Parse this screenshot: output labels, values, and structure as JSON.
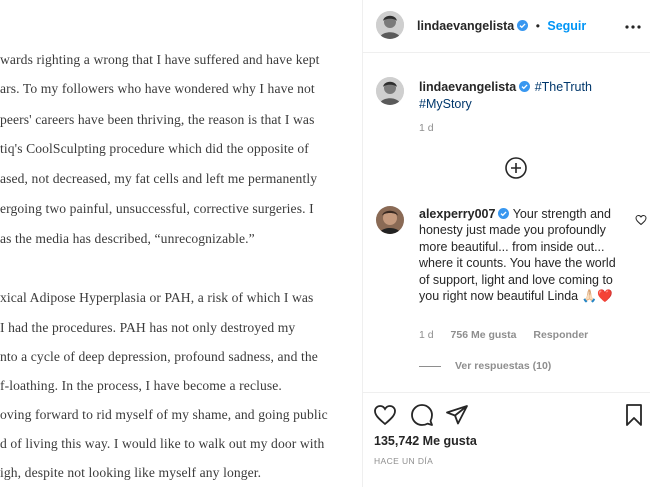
{
  "post_image": {
    "letter_lines": [
      "wards righting a wrong that I have suffered and have kept",
      "ars. To my followers who have wondered why I have not",
      "peers' careers have been thriving, the reason is that I was",
      "tiq's CoolSculpting procedure which did the opposite of",
      "ased, not decreased, my fat cells and left me permanently",
      "ergoing two painful, unsuccessful, corrective surgeries. I",
      " as the media has described, “unrecognizable.”",
      "",
      "xical Adipose Hyperplasia or PAH,  a risk of which I was",
      " I had the procedures. PAH has not only destroyed my",
      "nto a cycle of deep depression, profound sadness, and the",
      "f-loathing. In the process, I have become a recluse.",
      "oving forward to rid myself of my shame, and going public",
      "d of living this way. I would like to walk out my door with",
      "igh, despite not looking like myself any longer."
    ]
  },
  "header": {
    "username": "lindaevangelista",
    "separator": "•",
    "follow_label": "Seguir",
    "more_icon": "more-horizontal-icon"
  },
  "caption": {
    "username": "lindaevangelista",
    "hashtag1": "#TheTruth",
    "hashtag2": "#MyStory",
    "age": "1 d"
  },
  "load_more_icon": "plus-circle-icon",
  "comment": {
    "username": "alexperry007",
    "text": "Your strength and honesty just made you profoundly more beautiful... from inside out... where it counts. You have the world of support, light and love coming to you right now beautiful Linda",
    "emojis": "🙏🏻❤️",
    "age": "1 d",
    "likes": "756 Me gusta",
    "reply_label": "Responder",
    "view_replies": "Ver respuestas (10)"
  },
  "actions": {
    "likes_count": "135,742 Me gusta",
    "timestamp": "HACE UN DÍA"
  },
  "colors": {
    "accent": "#0095f6",
    "hashtag": "#00376b",
    "muted": "#8e8e8e",
    "text": "#262626",
    "heart": "#e0245e"
  }
}
